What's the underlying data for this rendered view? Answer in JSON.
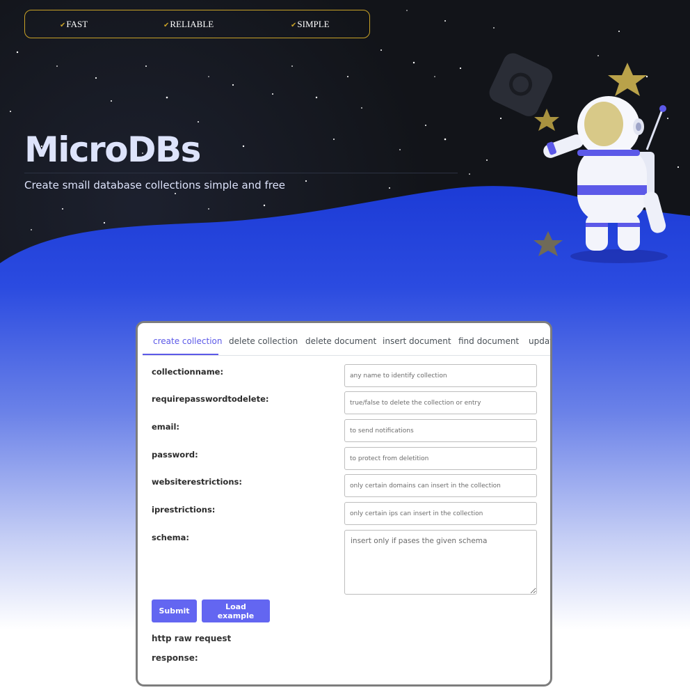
{
  "features": [
    {
      "check": "✔",
      "label": "FAST"
    },
    {
      "check": "✔",
      "label": "RELIABLE"
    },
    {
      "check": "✔",
      "label": "SIMPLE"
    }
  ],
  "hero": {
    "title": "MicroDBs",
    "subtitle": "Create small database collections simple and free"
  },
  "tabs": [
    {
      "label": "create collection",
      "active": true
    },
    {
      "label": "delete collection"
    },
    {
      "label": "delete document"
    },
    {
      "label": "insert document"
    },
    {
      "label": "find document"
    },
    {
      "label": "update document"
    }
  ],
  "form": {
    "fields": [
      {
        "label": "collectionname:",
        "placeholder": "any name to identify collection"
      },
      {
        "label": "requirepasswordtodelete:",
        "placeholder": "true/false to delete the collection or entry"
      },
      {
        "label": "email:",
        "placeholder": "to send notifications"
      },
      {
        "label": "password:",
        "placeholder": "to protect from deletition"
      },
      {
        "label": "websiterestrictions:",
        "placeholder": "only certain domains can insert in the collection"
      },
      {
        "label": "iprestrictions:",
        "placeholder": "only certain ips can insert in the collection"
      }
    ],
    "schema": {
      "label": "schema:",
      "placeholder": "insert only if pases the given schema"
    },
    "submit_label": "Submit",
    "load_example_label": "Load example"
  },
  "output": {
    "raw_request_label": "http raw request",
    "response_label": "response:"
  },
  "colors": {
    "accent": "#6366f1",
    "gold": "#c9a227",
    "sky": "#121419",
    "planet": "#2545d8"
  }
}
